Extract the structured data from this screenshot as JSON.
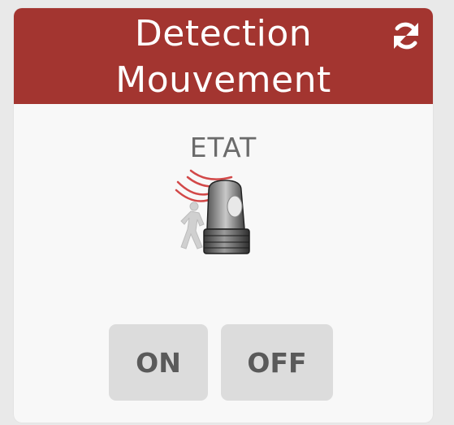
{
  "widget": {
    "title_line1": "Detection",
    "title_line2": "Mouvement",
    "header_color": "#a33530",
    "refresh_icon": "refresh-icon",
    "state_label": "ETAT",
    "state_icon": "motion-sensor-icon",
    "buttons": {
      "on_label": "ON",
      "off_label": "OFF"
    }
  }
}
